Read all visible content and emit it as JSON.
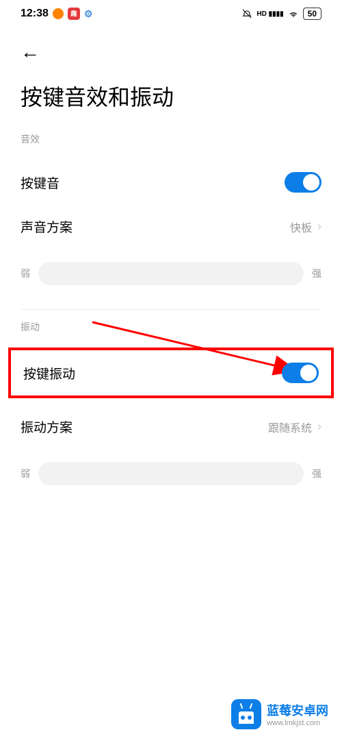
{
  "status": {
    "time": "12:38",
    "battery": "50"
  },
  "page": {
    "title": "按键音效和振动"
  },
  "sections": {
    "sound": {
      "label": "音效",
      "keypress_sound": "按键音",
      "sound_scheme": "声音方案",
      "sound_scheme_value": "快板",
      "slider_min": "弱",
      "slider_max": "强"
    },
    "vibration": {
      "label": "振动",
      "keypress_vibration": "按键振动",
      "vibration_scheme": "振动方案",
      "vibration_scheme_value": "跟随系统",
      "slider_min": "弱",
      "slider_max": "强"
    }
  },
  "watermark": {
    "title": "蓝莓安卓网",
    "url": "www.lmkjst.com"
  }
}
